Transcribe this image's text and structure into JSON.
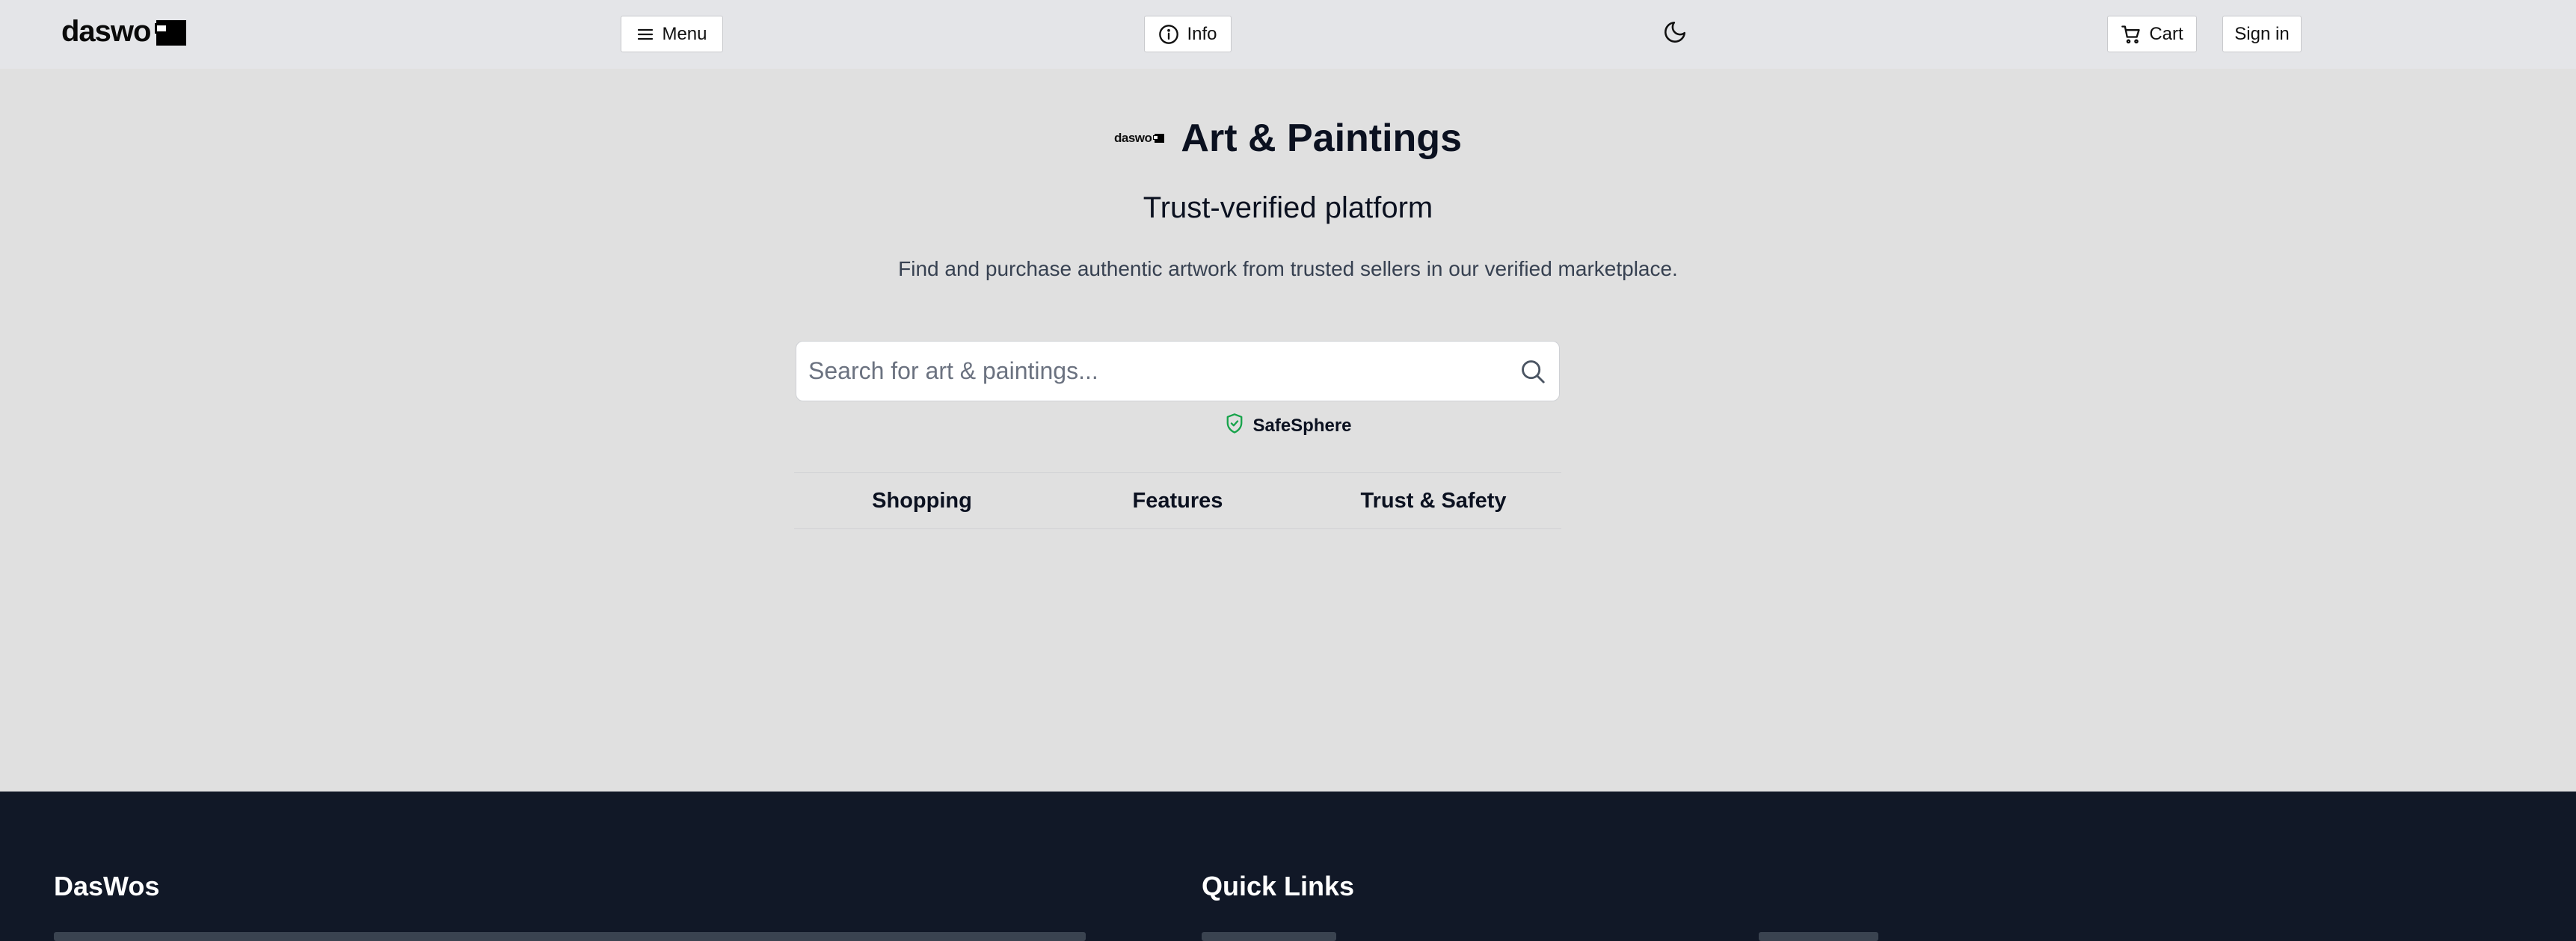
{
  "header": {
    "logo_text": "daswo",
    "menu_label": "Menu",
    "info_label": "Info",
    "cart_label": "Cart",
    "signin_label": "Sign in"
  },
  "hero": {
    "mini_logo_text": "daswo",
    "title": "Art & Paintings",
    "subtitle": "Trust-verified platform",
    "description": "Find and purchase authentic artwork from trusted sellers in our verified marketplace."
  },
  "search": {
    "placeholder": "Search for art & paintings...",
    "value": ""
  },
  "safesphere_label": "SafeSphere",
  "tabs": [
    {
      "label": "Shopping"
    },
    {
      "label": "Features"
    },
    {
      "label": "Trust & Safety"
    }
  ],
  "footer": {
    "brand": "DasWos",
    "quick_links_title": "Quick Links"
  },
  "colors": {
    "header_bg": "#e4e5e8",
    "page_bg": "#e0e0e0",
    "footer_bg": "#111827",
    "safesphere_green": "#16a34a"
  },
  "icons": [
    "menu-icon",
    "info-icon",
    "moon-icon",
    "cart-icon",
    "search-icon",
    "shield-check-icon"
  ]
}
